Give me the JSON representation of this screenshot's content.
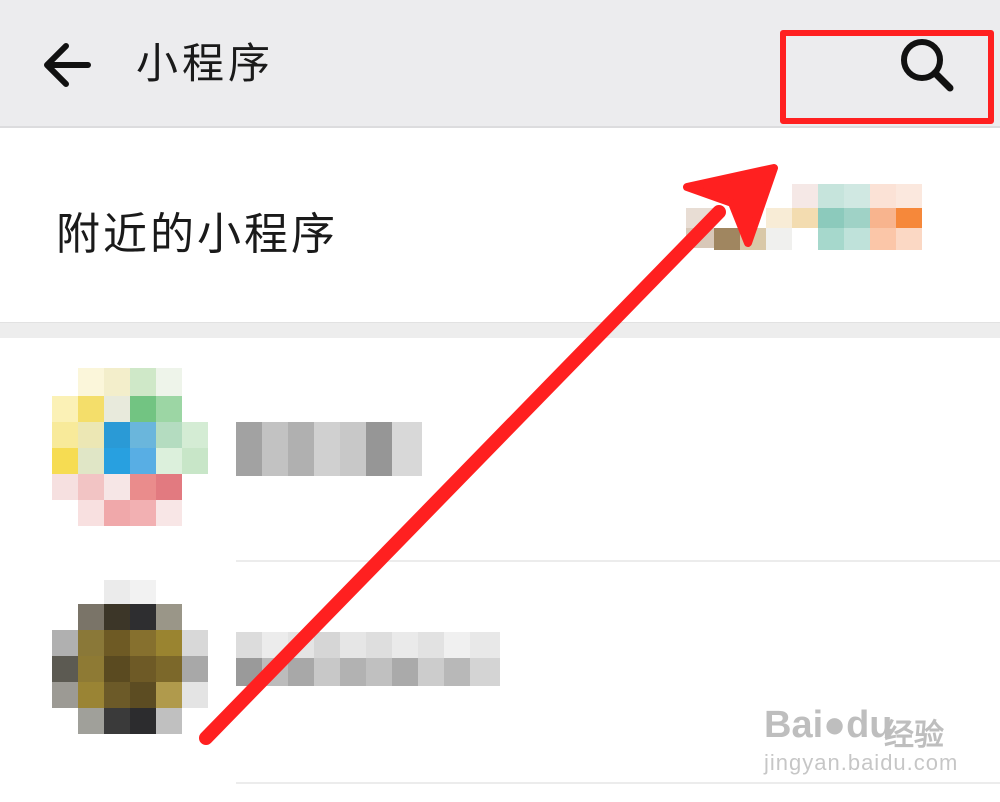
{
  "header": {
    "title": "小程序",
    "back_icon": "arrow-left-icon",
    "search_icon": "search-icon",
    "highlight_color": "#ff2020"
  },
  "nearby": {
    "label": "附近的小程序"
  },
  "list": {
    "items": [
      {
        "name": "",
        "avatar": "blurred"
      },
      {
        "name": "",
        "avatar": "blurred"
      }
    ]
  },
  "annotation": {
    "arrow_color": "#ff2020"
  },
  "watermark": {
    "brand": "Bai●du",
    "sub": "经验",
    "url": "jingyan.baidu.com"
  }
}
